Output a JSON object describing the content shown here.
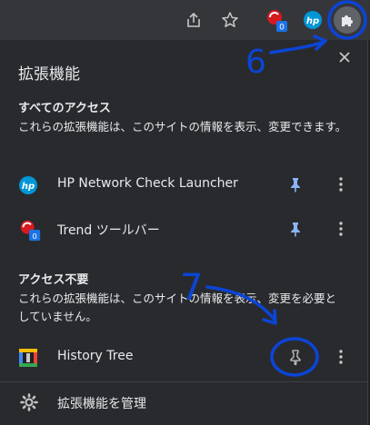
{
  "panel": {
    "title": "拡張機能",
    "close_icon": "close-icon"
  },
  "toolbar": {
    "icons": [
      "share-icon",
      "star-icon",
      "trend-micro-icon",
      "hp-icon",
      "puzzle-icon"
    ],
    "trend_badge": "0"
  },
  "section_full_access": {
    "heading": "すべてのアクセス",
    "description": "これらの拡張機能は、このサイトの情報を表示、変更できます。"
  },
  "section_no_access": {
    "heading": "アクセス不要",
    "description": "これらの拡張機能は、このサイトの情報を表示、変更を必要としていません。"
  },
  "extensions_full": [
    {
      "name": "HP Network Check Launcher",
      "icon": "hp-logo-icon",
      "pinned": true
    },
    {
      "name": "Trend ツールバー",
      "icon": "trend-micro-icon",
      "badge": "0",
      "pinned": true
    }
  ],
  "extensions_none": [
    {
      "name": "History Tree",
      "icon": "history-tree-icon",
      "pinned": false
    }
  ],
  "footer": {
    "manage_label": "拡張機能を管理",
    "icon": "gear-icon"
  },
  "annotations": {
    "step6": "6",
    "step7": "7",
    "color": "#0b45d6"
  },
  "colors": {
    "panel_bg": "#292a2d",
    "toolbar_bg": "#35363a",
    "pin_active": "#8ab4f8",
    "text": "#e8eaed"
  }
}
